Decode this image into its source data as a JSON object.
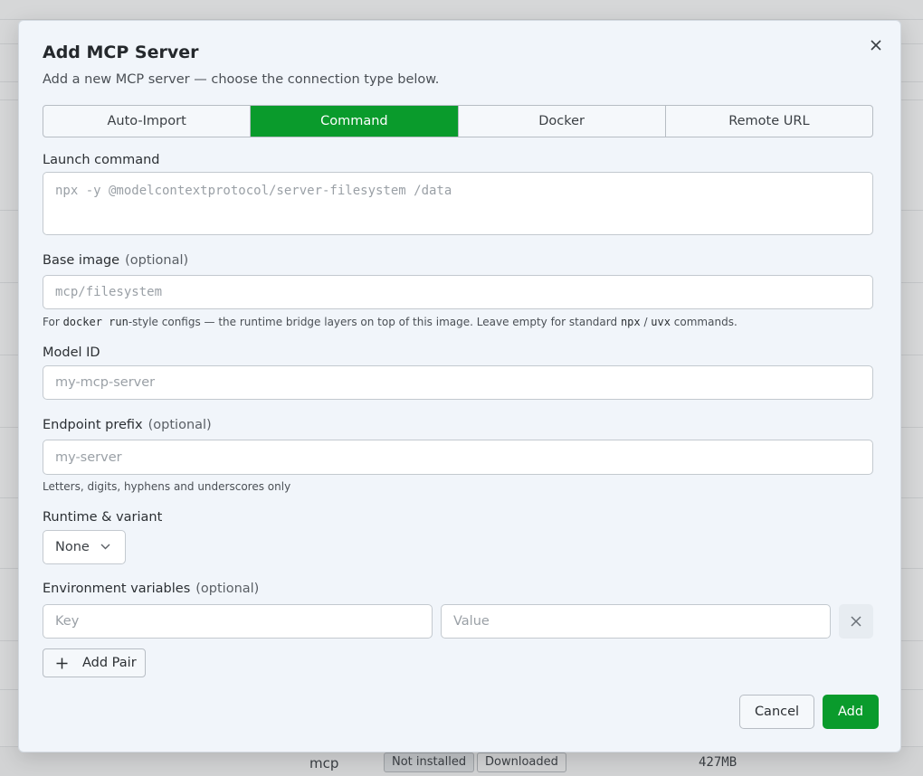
{
  "background": {
    "row": {
      "name": "mcp",
      "badges": [
        "Not installed",
        "Downloaded"
      ],
      "size": "427MB"
    }
  },
  "modal": {
    "title": "Add MCP Server",
    "subtitle": "Add a new MCP server — choose the connection type below.",
    "tabs": [
      {
        "label": "Auto-Import",
        "active": false
      },
      {
        "label": "Command",
        "active": true
      },
      {
        "label": "Docker",
        "active": false
      },
      {
        "label": "Remote URL",
        "active": false
      }
    ],
    "launch_command": {
      "label": "Launch command",
      "placeholder": "npx -y @modelcontextprotocol/server-filesystem /data"
    },
    "base_image": {
      "label": "Base image",
      "optional": "(optional)",
      "placeholder": "mcp/filesystem",
      "hint_prefix": "For ",
      "hint_code": "docker run",
      "hint_middle": "-style configs — the runtime bridge layers on top of this image. Leave empty for standard ",
      "hint_code2": "npx",
      "hint_sep": " / ",
      "hint_code3": "uvx",
      "hint_suffix": " commands."
    },
    "model_id": {
      "label": "Model ID",
      "placeholder": "my-mcp-server"
    },
    "endpoint_prefix": {
      "label": "Endpoint prefix",
      "optional": "(optional)",
      "placeholder": "my-server",
      "hint": "Letters, digits, hyphens and underscores only"
    },
    "runtime": {
      "label": "Runtime & variant",
      "value": "None"
    },
    "env_vars": {
      "label": "Environment variables",
      "optional": "(optional)",
      "key_placeholder": "Key",
      "value_placeholder": "Value",
      "add_pair_label": "Add Pair"
    },
    "footer": {
      "cancel_label": "Cancel",
      "add_label": "Add"
    }
  },
  "colors": {
    "accent": "#0a9b2c",
    "modal_bg": "#f1f5fa"
  }
}
